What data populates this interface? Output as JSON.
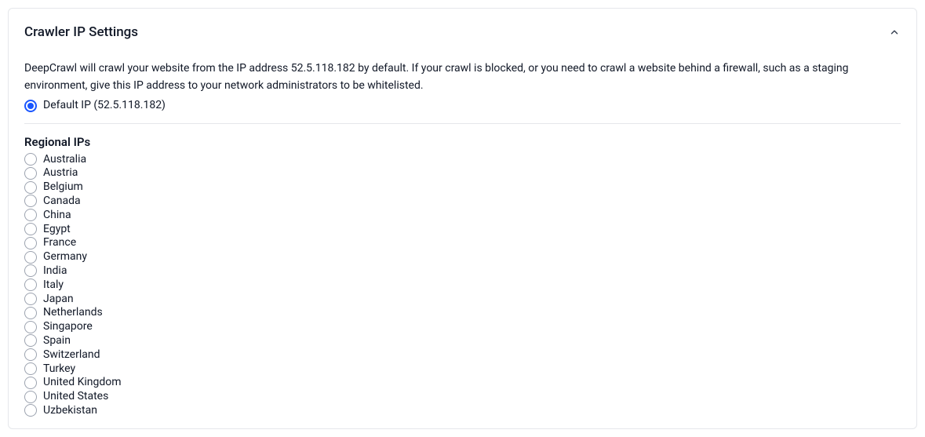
{
  "panel": {
    "title": "Crawler IP Settings",
    "description": "DeepCrawl will crawl your website from the IP address 52.5.118.182 by default. If your crawl is blocked, or you need to crawl a website behind a firewall, such as a staging environment, give this IP address to your network administrators to be whitelisted.",
    "default_ip_label": "Default IP (52.5.118.182)",
    "regional_title": "Regional IPs",
    "regional_options": [
      "Australia",
      "Austria",
      "Belgium",
      "Canada",
      "China",
      "Egypt",
      "France",
      "Germany",
      "India",
      "Italy",
      "Japan",
      "Netherlands",
      "Singapore",
      "Spain",
      "Switzerland",
      "Turkey",
      "United Kingdom",
      "United States",
      "Uzbekistan"
    ]
  }
}
